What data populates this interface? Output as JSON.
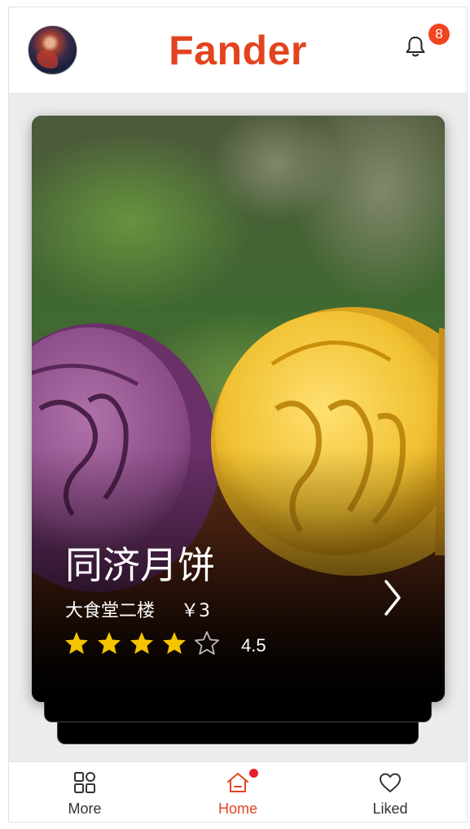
{
  "header": {
    "app_title": "Fander",
    "notification_count": "8"
  },
  "card": {
    "title": "同济月饼",
    "location": "大食堂二楼",
    "price": "￥3",
    "rating_value": "4.5",
    "rating_stars": 4,
    "rating_max": 5
  },
  "nav": {
    "items": [
      {
        "label": "More",
        "icon": "grid-icon",
        "active": false
      },
      {
        "label": "Home",
        "icon": "home-icon",
        "active": true
      },
      {
        "label": "Liked",
        "icon": "heart-icon",
        "active": false
      }
    ]
  },
  "colors": {
    "brand": "#e2441f",
    "badge": "#f2441f",
    "star": "#f5c400"
  }
}
